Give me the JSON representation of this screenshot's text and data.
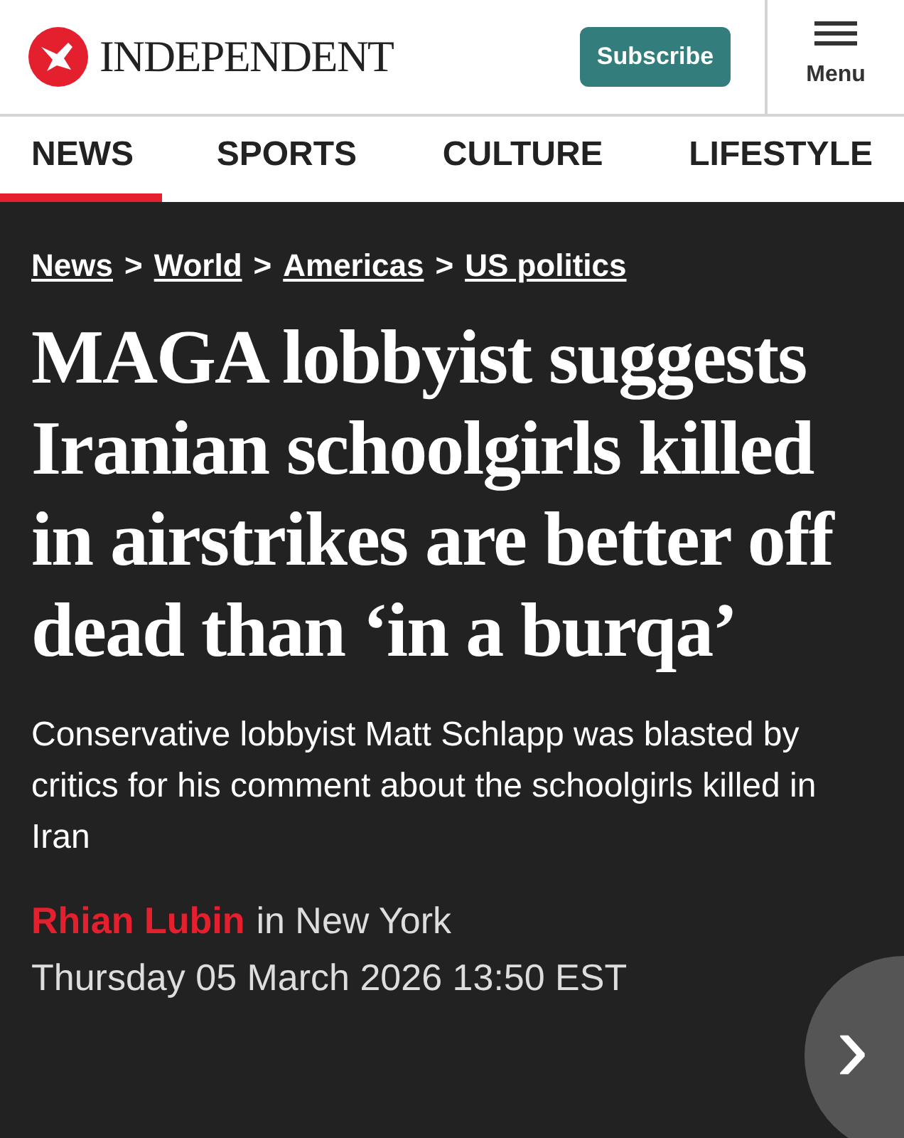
{
  "header": {
    "logo_text": "INDEPENDENT",
    "subscribe": "Subscribe",
    "menu": "Menu"
  },
  "tabs": [
    {
      "label": "NEWS",
      "selected": true
    },
    {
      "label": "SPORTS",
      "selected": false
    },
    {
      "label": "CULTURE",
      "selected": false
    },
    {
      "label": "LIFESTYLE",
      "selected": false
    }
  ],
  "breadcrumb": [
    {
      "kind": "link",
      "text": "News"
    },
    {
      "kind": "separator",
      "text": ">"
    },
    {
      "kind": "link",
      "text": "World"
    },
    {
      "kind": "separator",
      "text": ">"
    },
    {
      "kind": "link",
      "text": "Americas"
    },
    {
      "kind": "separator",
      "text": ">"
    },
    {
      "kind": "link",
      "text": "US politics"
    }
  ],
  "article": {
    "headline": "MAGA lobbyist suggests Iranian schoolgirls killed in airstrikes are better off dead than ‘in a burqa’",
    "standfirst": "Conservative lobbyist Matt Schlapp was blasted by critics for his comment about the schoolgirls killed in Iran",
    "author": "Rhian Lubin",
    "location": "in New York",
    "date": "Thursday 05 March 2026 13:50 EST"
  },
  "next_button": {
    "label": "›"
  }
}
